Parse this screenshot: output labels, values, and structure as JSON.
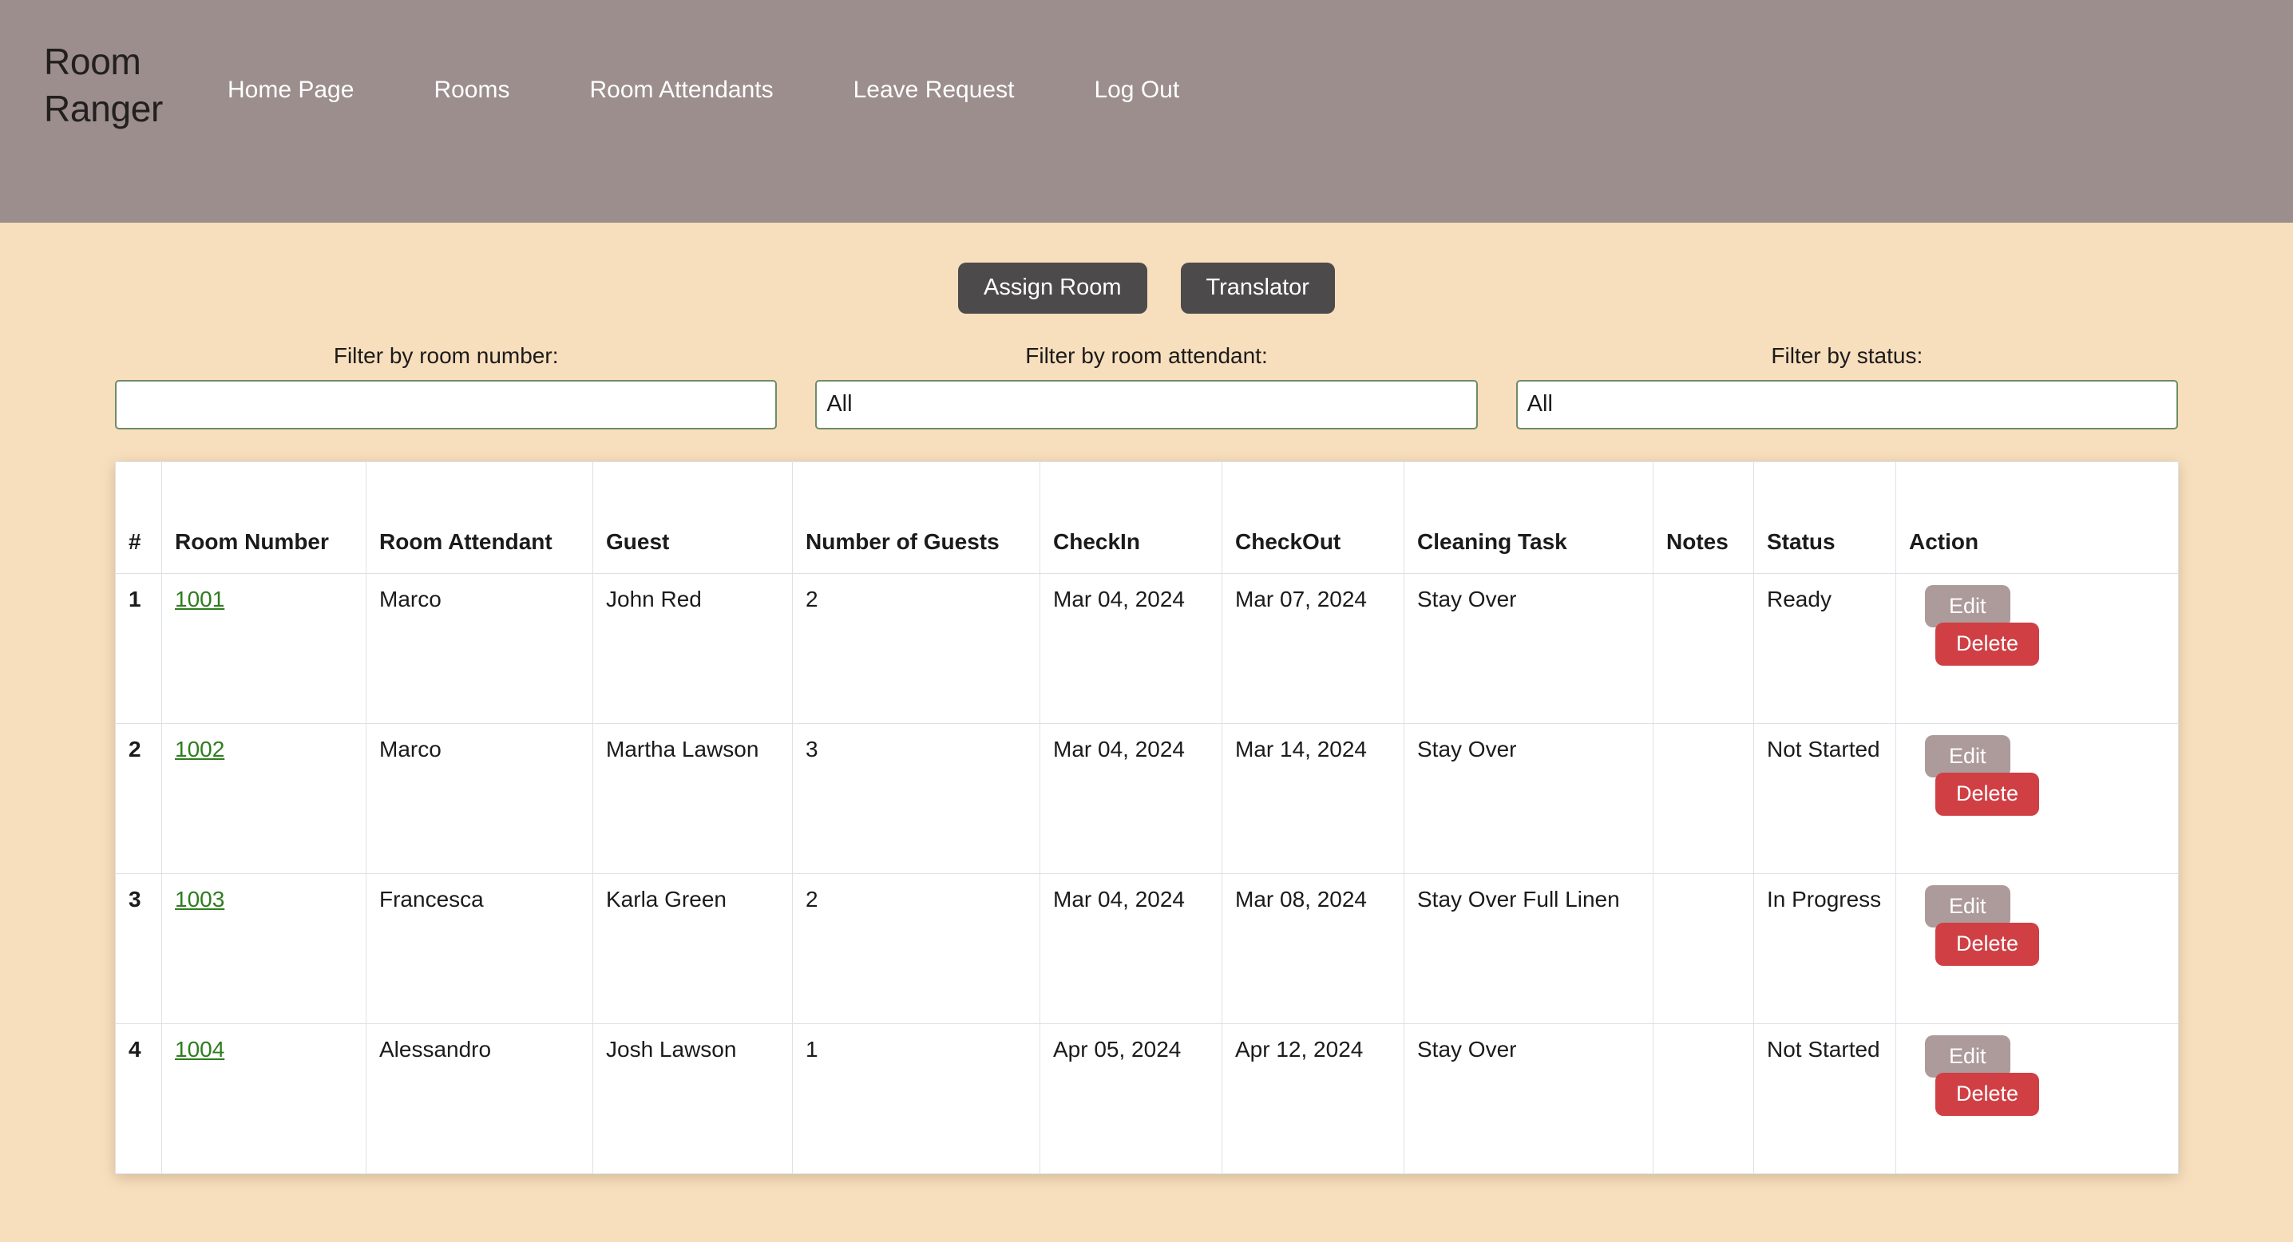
{
  "header": {
    "brand": "Room\nRanger",
    "nav": [
      {
        "label": "Home Page"
      },
      {
        "label": "Rooms"
      },
      {
        "label": "Room Attendants"
      },
      {
        "label": "Leave Request"
      },
      {
        "label": "Log Out"
      }
    ]
  },
  "actions": {
    "assign_room_label": "Assign Room",
    "translator_label": "Translator"
  },
  "filters": {
    "room_number": {
      "label": "Filter by room number:",
      "value": "",
      "placeholder": ""
    },
    "room_attendant": {
      "label": "Filter by room attendant:",
      "value": "All",
      "placeholder": ""
    },
    "status": {
      "label": "Filter by status:",
      "value": "All",
      "placeholder": ""
    }
  },
  "table": {
    "columns": [
      "#",
      "Room Number",
      "Room Attendant",
      "Guest",
      "Number of Guests",
      "CheckIn",
      "CheckOut",
      "Cleaning Task",
      "Notes",
      "Status",
      "Action"
    ],
    "row_action_labels": {
      "edit": "Edit",
      "delete": "Delete"
    },
    "rows": [
      {
        "index": "1",
        "room_number": "1001",
        "room_attendant": "Marco",
        "guest": "John Red",
        "number_of_guests": "2",
        "checkin": "Mar 04, 2024",
        "checkout": "Mar 07, 2024",
        "cleaning_task": "Stay Over",
        "notes": "",
        "status": "Ready",
        "status_kind": "ready"
      },
      {
        "index": "2",
        "room_number": "1002",
        "room_attendant": "Marco",
        "guest": "Martha Lawson",
        "number_of_guests": "3",
        "checkin": "Mar 04, 2024",
        "checkout": "Mar 14, 2024",
        "cleaning_task": "Stay Over",
        "notes": "",
        "status": "Not Started",
        "status_kind": "not-started"
      },
      {
        "index": "3",
        "room_number": "1003",
        "room_attendant": "Francesca",
        "guest": "Karla Green",
        "number_of_guests": "2",
        "checkin": "Mar 04, 2024",
        "checkout": "Mar 08, 2024",
        "cleaning_task": "Stay Over Full Linen",
        "notes": "",
        "status": "In Progress",
        "status_kind": "in-progress"
      },
      {
        "index": "4",
        "room_number": "1004",
        "room_attendant": "Alessandro",
        "guest": "Josh Lawson",
        "number_of_guests": "1",
        "checkin": "Apr 05, 2024",
        "checkout": "Apr 12, 2024",
        "cleaning_task": "Stay Over",
        "notes": "",
        "status": "Not Started",
        "status_kind": "not-started"
      }
    ]
  },
  "colors": {
    "header_bg": "#9b8e8d",
    "page_bg": "#f7dfbe",
    "button_dark": "#4d4a4b",
    "link_green": "#2e7d1e",
    "status_ready": "#2e7d1e",
    "status_not_started": "#ef3024",
    "status_in_progress": "#1110f0",
    "edit_button": "#ad9a9a",
    "delete_button": "#cf3f44",
    "input_border": "#6d8c64"
  }
}
